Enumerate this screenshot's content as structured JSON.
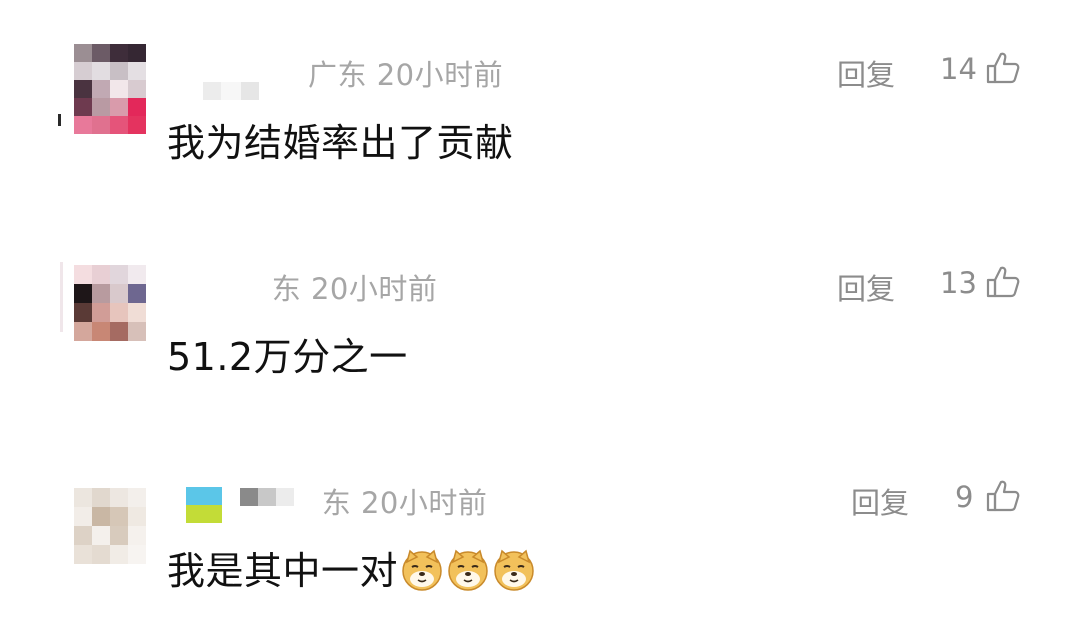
{
  "comments": [
    {
      "location": "广东",
      "time": "20小时前",
      "reply_label": "回复",
      "likes": "14",
      "text": "我为结婚率出了贡献",
      "emojis": []
    },
    {
      "location": "广东",
      "location_visible": " 东",
      "time": "20小时前",
      "reply_label": "回复",
      "likes": "13",
      "text": "51.2万分之一",
      "emojis": []
    },
    {
      "location": "广东",
      "location_visible": " 东",
      "time": "20小时前",
      "reply_label": "回复",
      "likes": "9",
      "text": "我是其中一对",
      "emojis": [
        "doge-emoji",
        "doge-emoji",
        "doge-emoji"
      ]
    }
  ],
  "icons": {
    "like": "thumbs-up-icon",
    "emoji": "doge-emoji"
  },
  "colors": {
    "meta_text": "#a6a6a6",
    "action_text": "#8c8c8c",
    "body_text": "#111111",
    "background": "#ffffff"
  }
}
